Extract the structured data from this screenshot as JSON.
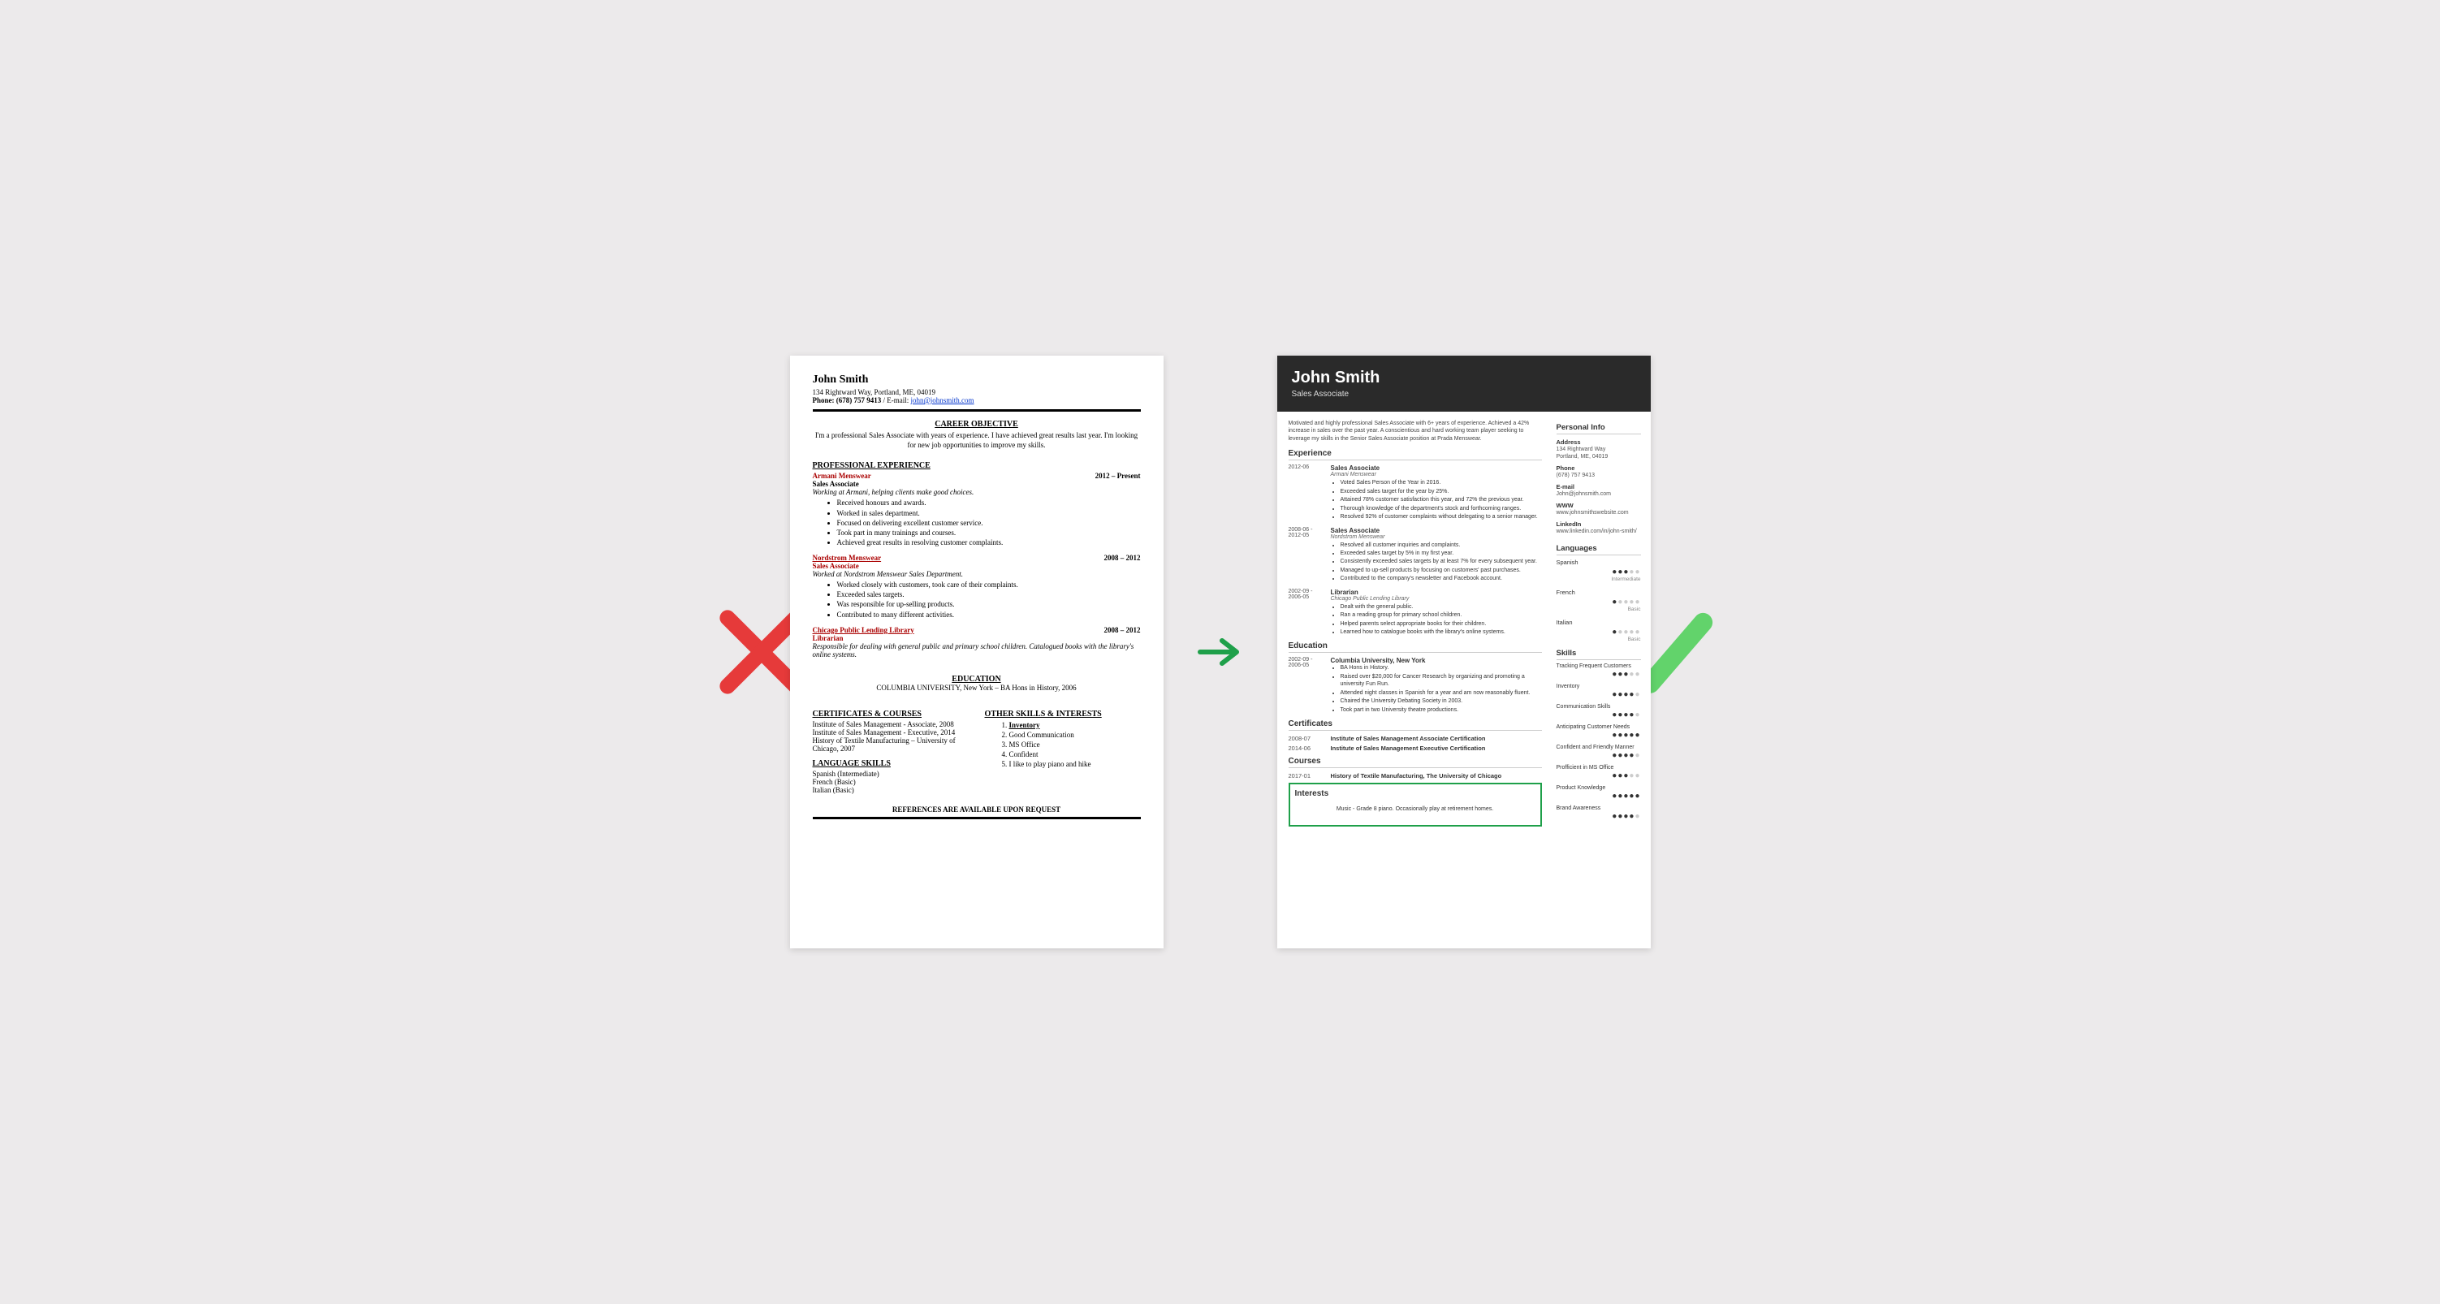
{
  "left": {
    "name": "John Smith",
    "address": "134 Rightward Way, Portland, ME, 04019",
    "phone_label": "Phone:",
    "phone": "(678) 757 9413",
    "email_label": "/ E-mail:",
    "email": "john@johnsmith.com",
    "career_h": "CAREER OBJECTIVE",
    "career_p": "I'm a professional Sales Associate with years of experience. I have achieved great results last year. I'm looking for new job opportunities to improve my skills.",
    "prof_h": "PROFESSIONAL EXPERIENCE",
    "jobs": [
      {
        "company": "Armani Menswear",
        "dates": "2012 – Present",
        "title": "Sales Associate",
        "blurb": "Working at Armani, helping clients make good choices.",
        "bullets": [
          "Received honours and awards.",
          "Worked in sales department.",
          "Focused on delivering excellent customer service.",
          "Took part in many trainings and courses.",
          "Achieved great results in resolving customer complaints."
        ]
      },
      {
        "company": "Nordstrom Menswear",
        "dates": "2008 – 2012",
        "title": "Sales Associate",
        "blurb": "Worked at Nordstrom Menswear Sales Department.",
        "bullets": [
          "Worked closely with customers, took care of their complaints.",
          "Exceeded sales targets.",
          "Was responsible for up-selling products.",
          "Contributed to many different activities."
        ]
      },
      {
        "company": "Chicago Public Lending Library",
        "dates": "2008 – 2012",
        "title": "Librarian",
        "blurb": "Responsible for dealing with general public and primary school children. Catalogued books with the library's online systems.",
        "bullets": []
      }
    ],
    "edu_h": "EDUCATION",
    "edu_p": "COLUMBIA UNIVERSITY, New York  – BA Hons in History, 2006",
    "cert_h": "CERTIFICATES & COURSES",
    "certs": [
      "Institute of Sales Management - Associate, 2008",
      "Institute of Sales Management  - Executive, 2014",
      "History of Textile Manufacturing – University of Chicago, 2007"
    ],
    "skills_h": "OTHER SKILLS & INTERESTS",
    "skills": [
      "Inventory",
      "Good Communication",
      "MS Office",
      "Confident",
      "I like to play piano and hike"
    ],
    "lang_h": "LANGUAGE SKILLS",
    "langs": [
      "Spanish (Intermediate)",
      "French (Basic)",
      "Italian (Basic)"
    ],
    "refs": "REFERENCES ARE AVAILABLE UPON REQUEST"
  },
  "right": {
    "name": "John Smith",
    "title": "Sales Associate",
    "summary": "Motivated and highly professional Sales Associate with 6+ years of experience.  Achieved a 42% increase in sales over the past year. A conscientious and hard working team player seeking to leverage my skills in the Senior Sales Associate position at Prada Menswear.",
    "exp_h": "Experience",
    "exp": [
      {
        "dates": "2012-06",
        "title": "Sales Associate",
        "company": "Armani Menswear",
        "bullets": [
          "Voted Sales Person of the Year in 2016.",
          "Exceeded sales target for the year by 25%.",
          "Attained 78% customer satisfaction this year, and 72% the previous year.",
          "Thorough knowledge of the department's stock and forthcoming ranges.",
          "Resolved 92% of customer complaints without delegating to a senior manager."
        ]
      },
      {
        "dates": "2008-06 - 2012-05",
        "title": "Sales Associate",
        "company": "Nordstrom Menswear",
        "bullets": [
          "Resolved all customer inquiries and complaints.",
          "Exceeded sales target by 5% in my first year.",
          "Consistently exceeded sales targets by at least 7% for every subsequent year.",
          "Managed to up-sell products by focusing on customers' past purchases.",
          "Contributed to the company's newsletter and Facebook account."
        ]
      },
      {
        "dates": "2002-09 - 2006-05",
        "title": "Librarian",
        "company": "Chicago Public Lending Library",
        "bullets": [
          "Dealt with the general public.",
          "Ran a reading group for primary school children.",
          "Helped parents select appropriate books for their children.",
          "Learned how to catalogue books with the library's online systems."
        ]
      }
    ],
    "edu_h": "Education",
    "edu": {
      "dates": "2002-09 - 2006-05",
      "title": "Columbia University, New York",
      "bullets": [
        "BA Hons in History.",
        "Raised over $20,000 for Cancer Research by organizing and promoting a university Fun Run.",
        "Attended night classes in Spanish for a year and am now reasonably fluent.",
        "Chaired the University Debating Society in 2003.",
        "Took part in two University theatre productions."
      ]
    },
    "cert_h": "Certificates",
    "certs": [
      {
        "date": "2008-07",
        "title": "Institute of Sales Management Associate Certification"
      },
      {
        "date": "2014-06",
        "title": "Institute of Sales Management Executive Certification"
      }
    ],
    "course_h": "Courses",
    "courses": [
      {
        "date": "2017-01",
        "title": "History of Textile Manufacturing, The University of Chicago"
      }
    ],
    "int_h": "Interests",
    "int_text": "Music - Grade 8 piano. Occasionally play at retirement homes.",
    "pi_h": "Personal Info",
    "pi": {
      "address_l": "Address",
      "address_v1": "134 Rightward Way",
      "address_v2": "Portland, ME, 04019",
      "phone_l": "Phone",
      "phone_v": "(678) 757 9413",
      "email_l": "E-mail",
      "email_v": "John@johnsmith.com",
      "www_l": "WWW",
      "www_v": "www.johnsmithswebsite.com",
      "li_l": "LinkedIn",
      "li_v": "www.linkedin.com/in/john-smith/"
    },
    "lang_h": "Languages",
    "langs": [
      {
        "name": "Spanish",
        "level": "Intermediate",
        "dots": 3
      },
      {
        "name": "French",
        "level": "Basic",
        "dots": 1
      },
      {
        "name": "Italian",
        "level": "Basic",
        "dots": 1
      }
    ],
    "skills_h": "Skills",
    "skills": [
      {
        "name": "Tracking Frequent Customers",
        "dots": 3
      },
      {
        "name": "Inventory",
        "dots": 4
      },
      {
        "name": "Communication Skills",
        "dots": 4
      },
      {
        "name": "Anticipating Customer Needs",
        "dots": 5
      },
      {
        "name": "Confident and Friendly Manner",
        "dots": 4
      },
      {
        "name": "Profficient in MS Office",
        "dots": 3
      },
      {
        "name": "Product Knowledge",
        "dots": 5
      },
      {
        "name": "Brand Awareness",
        "dots": 4
      }
    ]
  }
}
